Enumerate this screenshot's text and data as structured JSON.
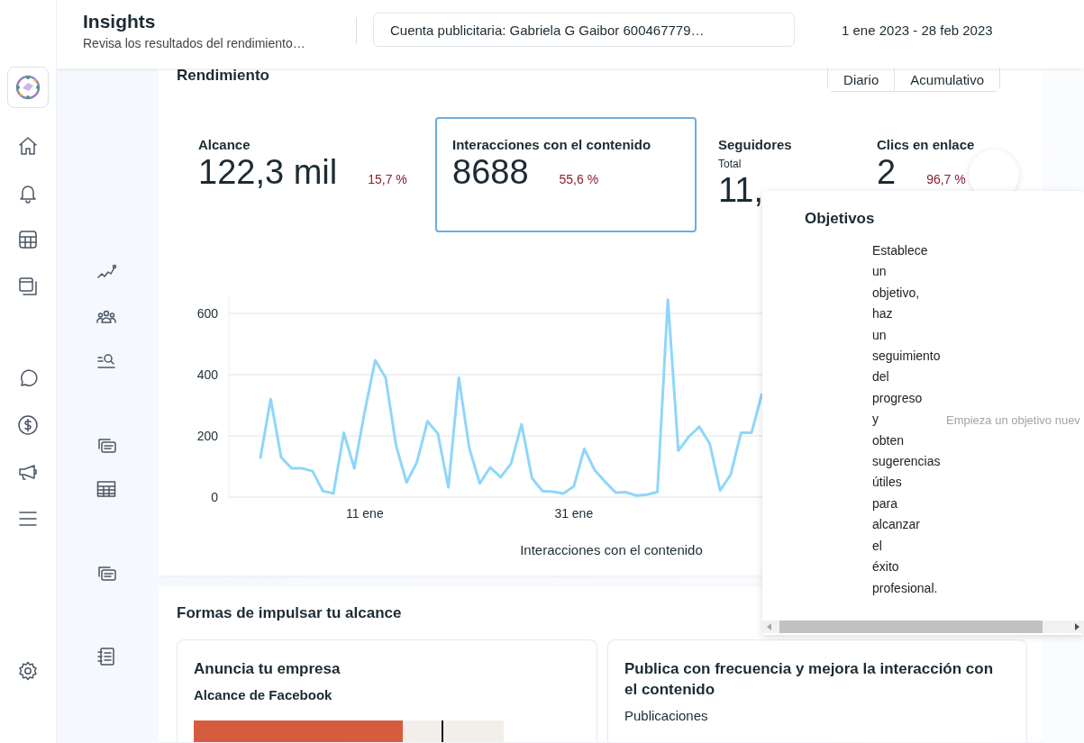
{
  "header": {
    "title": "Insights",
    "subtitle": "Revisa los resultados del rendimiento…",
    "account": "Cuenta publicitaria: Gabriela G Gaibor 600467779…",
    "date_range": "1 ene 2023 - 28 feb 2023"
  },
  "performance": {
    "title": "Rendimiento",
    "view_toggle": [
      {
        "label": "Diario",
        "selected": false
      },
      {
        "label": "Acumulativo",
        "selected": false
      }
    ],
    "metrics": [
      {
        "label": "Alcance",
        "value": "122,3 mil",
        "change": "15,7 %",
        "selected": false
      },
      {
        "label": "Interacciones con el contenido",
        "value": "8688",
        "change": "55,6 %",
        "selected": true
      },
      {
        "label": "Seguidores",
        "sublabel": "Total",
        "value": "11,",
        "selected": false
      },
      {
        "label": "Clics en enlace",
        "value": "2",
        "change": "96,7 %",
        "selected": false
      }
    ],
    "chart_data": {
      "type": "line",
      "xlabel": "Interacciones con el contenido",
      "x": [
        1,
        2,
        3,
        4,
        5,
        6,
        7,
        8,
        9,
        10,
        11,
        12,
        13,
        14,
        15,
        16,
        17,
        18,
        19,
        20,
        21,
        22,
        23,
        24,
        25,
        26,
        27,
        28,
        29,
        30,
        31,
        32,
        33,
        34,
        35,
        36,
        37,
        38,
        39,
        40,
        41,
        42,
        43,
        44,
        45,
        46,
        47,
        48,
        49
      ],
      "xlim": [
        -2,
        73
      ],
      "grid": true,
      "ylim": [
        0,
        660
      ],
      "xticks": [
        {
          "value": 11,
          "label": "11 ene"
        },
        {
          "value": 31,
          "label": "31 ene"
        }
      ],
      "yticks": [
        0,
        200,
        400,
        600
      ],
      "series": [
        {
          "color": "#8fd6fb",
          "values": [
            126,
            320,
            130,
            94,
            94,
            85,
            20,
            12,
            210,
            94,
            280,
            447,
            390,
            168,
            48,
            115,
            248,
            207,
            32,
            390,
            160,
            45,
            97,
            65,
            110,
            238,
            62,
            20,
            18,
            12,
            35,
            158,
            88,
            50,
            15,
            16,
            5,
            8,
            17,
            645,
            152,
            197,
            230,
            175,
            22,
            73,
            210,
            210,
            338
          ]
        }
      ]
    }
  },
  "boost": {
    "title": "Formas de impulsar tu alcance",
    "cards": [
      {
        "kind": "bar",
        "title": "Anuncia tu empresa",
        "subtitle": "Alcance de Facebook",
        "level": 0.674
      },
      {
        "kind": "text",
        "title": "Publica con frecuencia y mejora la interacción con el contenido",
        "subtitle": "Publicaciones"
      }
    ]
  },
  "goals_popup": {
    "title": "Objetivos",
    "text": "Establece un objetivo, haz un seguimiento del progreso y obten sugerencias útiles para alcanzar el éxito profesional.",
    "field": {
      "placeholder": "Empieza un objetivo nuev"
    }
  }
}
